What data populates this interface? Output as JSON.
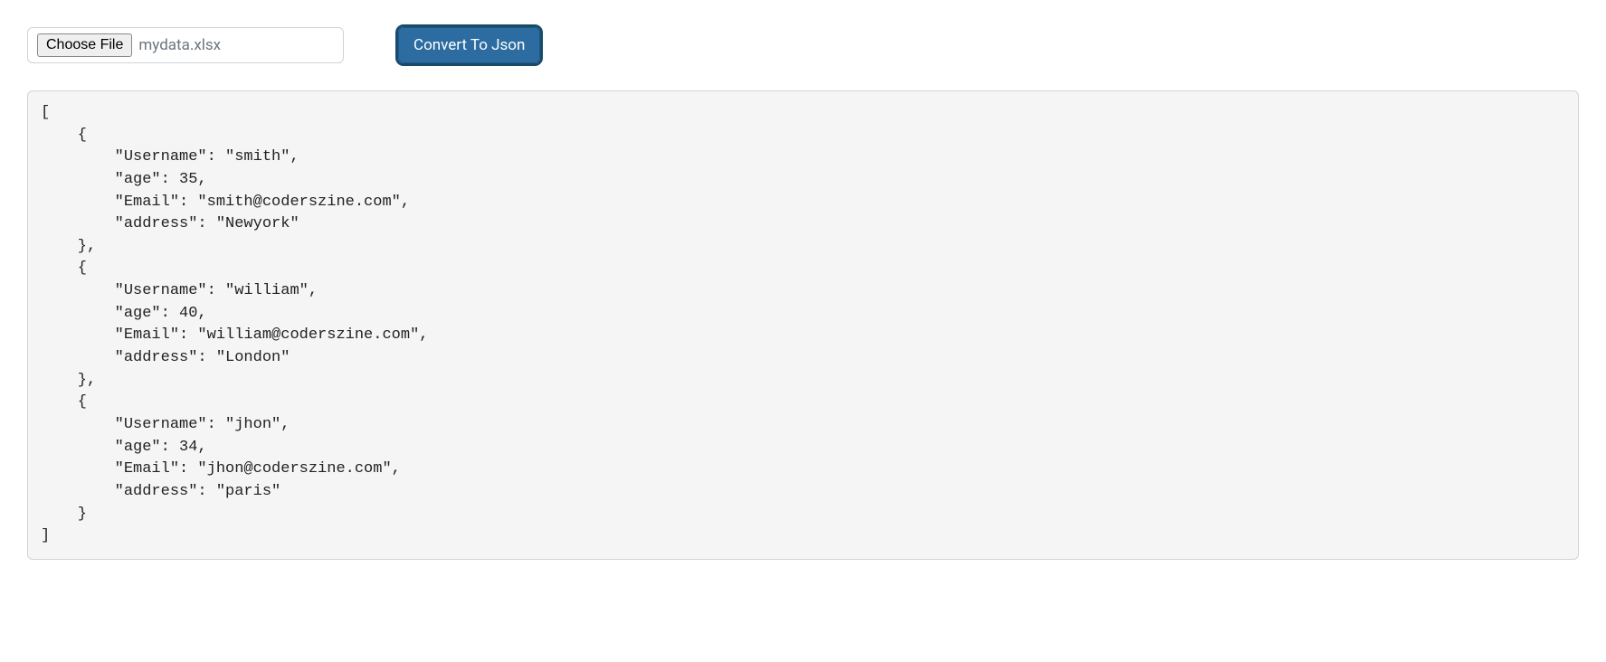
{
  "controls": {
    "choose_file_label": "Choose File",
    "selected_file_name": "mydata.xlsx",
    "convert_button_label": "Convert To Json"
  },
  "output": {
    "records": [
      {
        "Username": "smith",
        "age": 35,
        "Email": "smith@coderszine.com",
        "address": "Newyork"
      },
      {
        "Username": "william",
        "age": 40,
        "Email": "william@coderszine.com",
        "address": "London"
      },
      {
        "Username": "jhon",
        "age": 34,
        "Email": "jhon@coderszine.com",
        "address": "paris"
      }
    ]
  }
}
